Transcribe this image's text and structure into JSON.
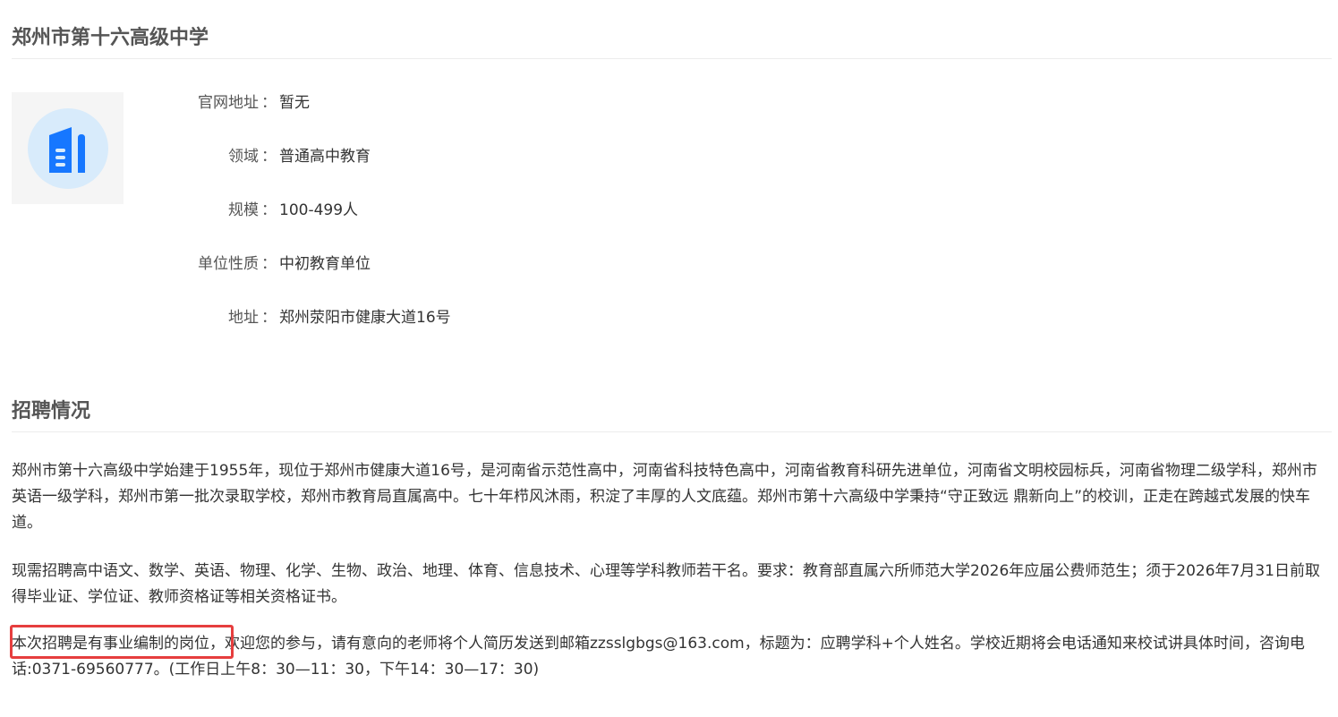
{
  "company": {
    "name": "郑州市第十六高级中学",
    "logo_icon": "building-icon",
    "accent_color": "#1677ff"
  },
  "info": {
    "colon": "：",
    "rows": [
      {
        "label": "官网地址",
        "value": "暂无"
      },
      {
        "label": "领域",
        "value": "普通高中教育"
      },
      {
        "label": "规模",
        "value": "100-499人"
      },
      {
        "label": "单位性质",
        "value": "中初教育单位"
      },
      {
        "label": "地址",
        "value": "郑州荥阳市健康大道16号"
      }
    ]
  },
  "recruitment": {
    "title": "招聘情况",
    "paragraphs": [
      "郑州市第十六高级中学始建于1955年，现位于郑州市健康大道16号，是河南省示范性高中，河南省科技特色高中，河南省教育科研先进单位，河南省文明校园标兵，河南省物理二级学科，郑州市英语一级学科，郑州市第一批次录取学校，郑州市教育局直属高中。七十年栉风沐雨，积淀了丰厚的人文底蕴。郑州市第十六高级中学秉持“守正致远 鼎新向上”的校训，正走在跨越式发展的快车道。",
      "现需招聘高中语文、数学、英语、物理、化学、生物、政治、地理、体育、信息技术、心理等学科教师若干名。要求：教育部直属六所师范大学2026年应届公费师范生；须于2026年7月31日前取得毕业证、学位证、教师资格证等相关资格证书。",
      "本次招聘是有事业编制的岗位，欢迎您的参与，请有意向的老师将个人简历发送到邮箱zzsslgbgs@163.com，标题为：应聘学科+个人姓名。学校近期将会电话通知来校试讲具体时间，咨询电话:0371-69560777。(工作日上午8：30—11：30，下午14：30—17：30)"
    ],
    "highlight_color": "#e63e3e"
  }
}
